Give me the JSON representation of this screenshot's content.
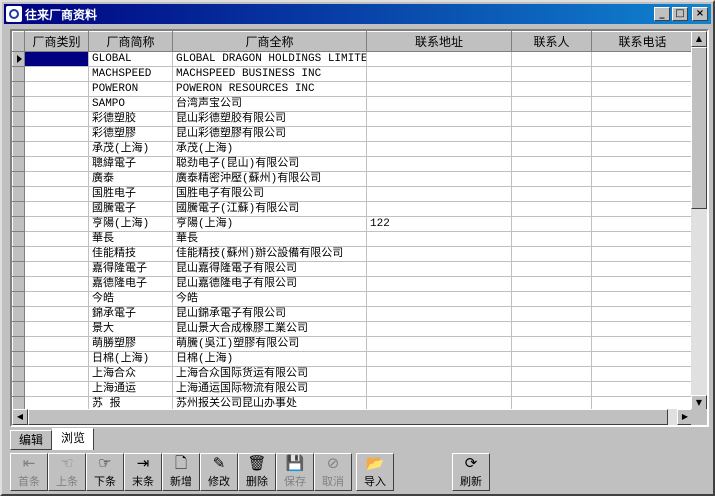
{
  "window": {
    "title": "往来厂商资料",
    "min": "_",
    "max": "□",
    "close": "×"
  },
  "columns": [
    "厂商类别",
    "厂商简称",
    "厂商全称",
    "联系地址",
    "联系人",
    "联系电话"
  ],
  "rows": [
    [
      "",
      "GLOBAL",
      "GLOBAL DRAGON HOLDINGS LIMITED",
      "",
      "",
      ""
    ],
    [
      "",
      "MACHSPEED",
      "MACHSPEED BUSINESS INC",
      "",
      "",
      ""
    ],
    [
      "",
      "POWERON",
      "POWERON RESOURCES INC",
      "",
      "",
      ""
    ],
    [
      "",
      "SAMPO",
      "台湾声宝公司",
      "",
      "",
      ""
    ],
    [
      "",
      "彩德塑胶",
      "昆山彩德塑胶有限公司",
      "",
      "",
      ""
    ],
    [
      "",
      "彩德塑膠",
      "昆山彩德塑膠有限公司",
      "",
      "",
      ""
    ],
    [
      "",
      "承茂(上海)",
      "承茂(上海)",
      "",
      "",
      ""
    ],
    [
      "",
      "聰緯電子",
      "聪劲电子(昆山)有限公司",
      "",
      "",
      ""
    ],
    [
      "",
      "廣泰",
      "廣泰精密沖壓(蘇州)有限公司",
      "",
      "",
      ""
    ],
    [
      "",
      "国胜电子",
      "国胜电子有限公司",
      "",
      "",
      ""
    ],
    [
      "",
      "國騰電子",
      "國騰電子(江蘇)有限公司",
      "",
      "",
      ""
    ],
    [
      "",
      "亨陽(上海)",
      "亨陽(上海)",
      "122",
      "",
      ""
    ],
    [
      "",
      "華長",
      "華長",
      "",
      "",
      ""
    ],
    [
      "",
      "佳能精技",
      "佳能精技(蘇州)辦公設備有限公司",
      "",
      "",
      ""
    ],
    [
      "",
      "嘉得隆電子",
      "昆山嘉得隆電子有限公司",
      "",
      "",
      ""
    ],
    [
      "",
      "嘉德隆电子",
      "昆山嘉德隆电子有限公司",
      "",
      "",
      ""
    ],
    [
      "",
      "今皓",
      "今皓",
      "",
      "",
      ""
    ],
    [
      "",
      "錦承電子",
      "昆山錦承電子有限公司",
      "",
      "",
      ""
    ],
    [
      "",
      "景大",
      "昆山景大合成橡膠工業公司",
      "",
      "",
      ""
    ],
    [
      "",
      "萌勝塑膠",
      "萌騰(吳江)塑膠有限公司",
      "",
      "",
      ""
    ],
    [
      "",
      "日棉(上海)",
      "日棉(上海)",
      "",
      "",
      ""
    ],
    [
      "",
      "上海合众",
      "上海合众国际货运有限公司",
      "",
      "",
      ""
    ],
    [
      "",
      "上海通运",
      "上海通运国际物流有限公司",
      "",
      "",
      ""
    ],
    [
      "",
      "苏 报",
      "苏州报关公司昆山办事处",
      "",
      "",
      ""
    ]
  ],
  "tabs": [
    "编辑",
    "浏览"
  ],
  "toolbar": [
    {
      "label": "首条",
      "icon": "first-record-icon",
      "glyph": "⇤",
      "enabled": false
    },
    {
      "label": "上条",
      "icon": "prev-record-icon",
      "glyph": "☜",
      "enabled": false
    },
    {
      "label": "下条",
      "icon": "next-record-icon",
      "glyph": "☞",
      "enabled": true
    },
    {
      "label": "末条",
      "icon": "last-record-icon",
      "glyph": "⇥",
      "enabled": true
    },
    {
      "label": "新增",
      "icon": "new-document-icon",
      "glyph": "🗋",
      "enabled": true
    },
    {
      "label": "修改",
      "icon": "edit-document-icon",
      "glyph": "✎",
      "enabled": true
    },
    {
      "label": "删除",
      "icon": "trash-icon",
      "glyph": "🗑",
      "enabled": true
    },
    {
      "label": "保存",
      "icon": "save-disk-icon",
      "glyph": "💾",
      "enabled": false
    },
    {
      "label": "取消",
      "icon": "cancel-icon",
      "glyph": "⊘",
      "enabled": false
    },
    {
      "label": "导入",
      "icon": "import-folder-icon",
      "glyph": "📂",
      "enabled": true
    },
    {
      "label": "刷新",
      "icon": "refresh-icon",
      "glyph": "⟳",
      "enabled": true
    }
  ]
}
